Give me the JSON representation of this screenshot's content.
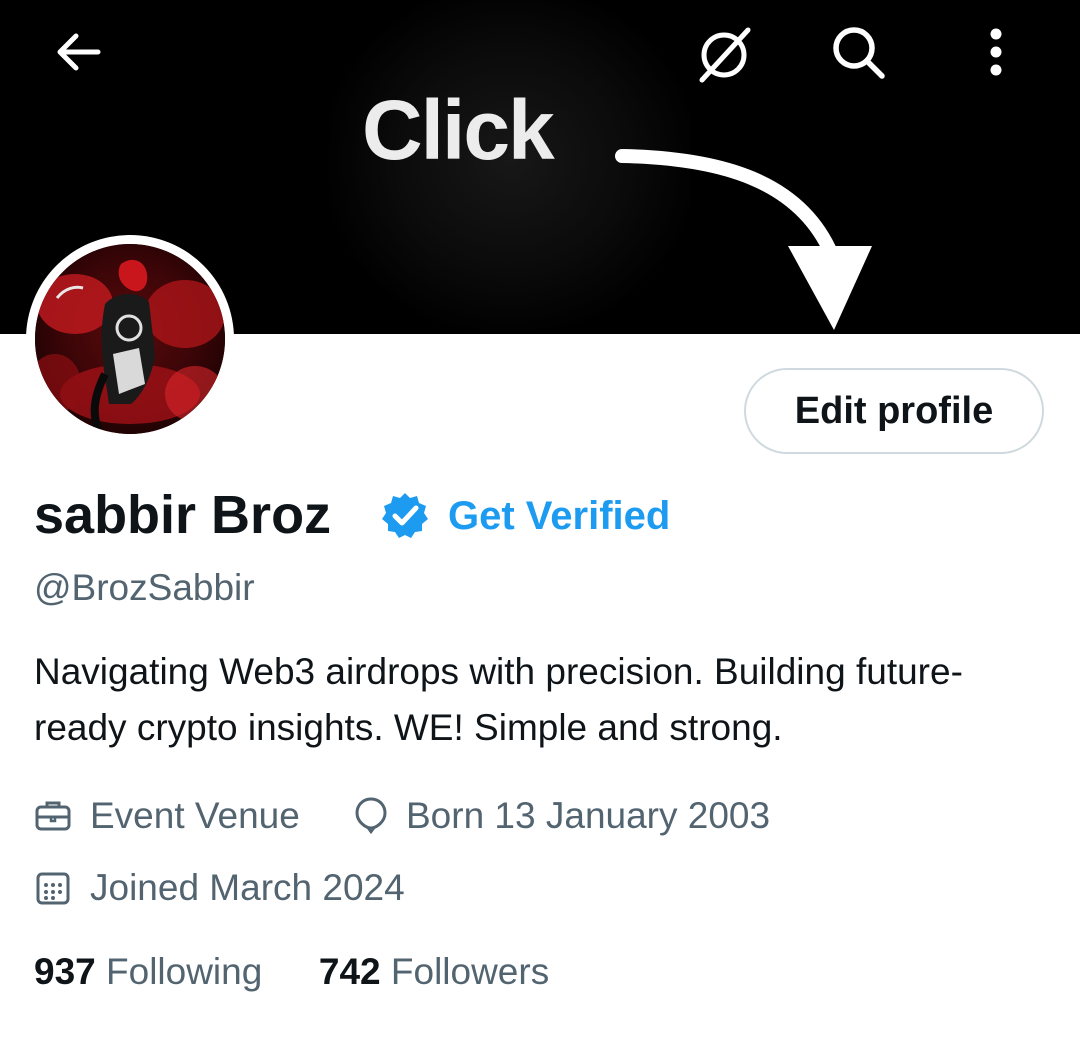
{
  "banner": {
    "text": "Click"
  },
  "header": {
    "back_icon": "arrow-left-icon",
    "grok_icon": "grok-icon",
    "search_icon": "search-icon",
    "more_icon": "more-vertical-icon"
  },
  "profile": {
    "edit_button_label": "Edit profile",
    "display_name": "sabbir Broz",
    "verified_badge_icon": "verified-badge-icon",
    "get_verified_label": "Get Verified",
    "handle": "@BrozSabbir",
    "bio": "Navigating Web3 airdrops with precision.  Building future-ready crypto insights. WE! Simple and strong.",
    "category": "Event Venue",
    "birthday": "Born 13 January 2003",
    "joined": "Joined March 2024",
    "following_count": "937",
    "following_label": "Following",
    "followers_count": "742",
    "followers_label": "Followers"
  },
  "colors": {
    "accent": "#1d9bf0",
    "text_primary": "#0f1419",
    "text_secondary": "#536471",
    "border": "#cfd9de"
  }
}
